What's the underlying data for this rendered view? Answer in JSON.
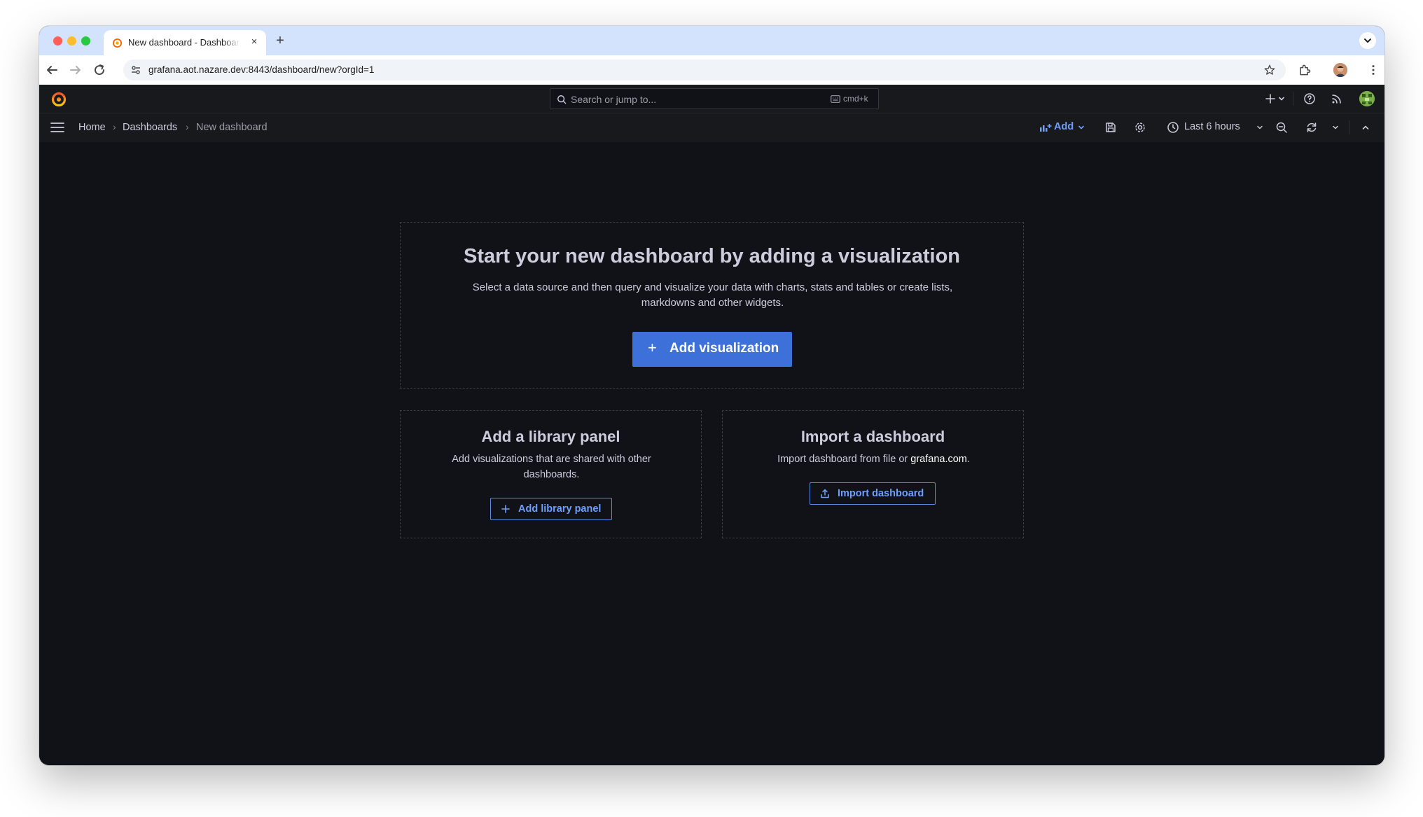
{
  "browser": {
    "tab_title": "New dashboard - Dashboards - Grafana",
    "new_tab_label": "+",
    "close_label": "×",
    "url": "grafana.aot.nazare.dev:8443/dashboard/new?orgId=1"
  },
  "grafana": {
    "search": {
      "placeholder": "Search or jump to...",
      "shortcut": "cmd+k"
    },
    "breadcrumb": {
      "items": [
        "Home",
        "Dashboards",
        "New dashboard"
      ],
      "separator": "›"
    },
    "toolbar": {
      "add_label": "Add",
      "time_range": "Last 6 hours"
    },
    "empty_state": {
      "title": "Start your new dashboard by adding a visualization",
      "description": "Select a data source and then query and visualize your data with charts, stats and tables or create lists, markdowns and other widgets.",
      "button_label": "Add visualization",
      "button_icon": "+"
    },
    "library_panel": {
      "title": "Add a library panel",
      "description": "Add visualizations that are shared with other dashboards.",
      "button_label": "Add library panel"
    },
    "import": {
      "title": "Import a dashboard",
      "description_prefix": "Import dashboard from file or ",
      "description_link": "grafana.com",
      "description_suffix": ".",
      "button_label": "Import dashboard"
    }
  },
  "colors": {
    "background": "#111217",
    "chrome_bar": "#18191d",
    "primary": "#3d71d9",
    "primary_text": "#6e9fff",
    "text": "#ccccdc",
    "browser_tabstrip": "#d3e3fd"
  }
}
